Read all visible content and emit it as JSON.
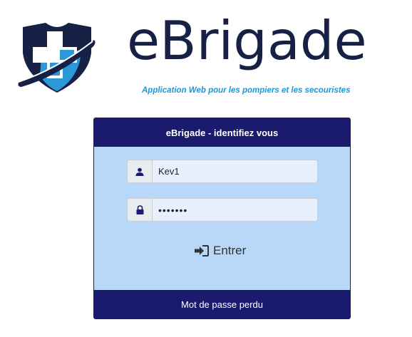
{
  "brand": {
    "name": "eBrigade",
    "tagline": "Application Web pour les pompiers et les secouristes",
    "colors": {
      "navy": "#172045",
      "accent_blue": "#1f96d6",
      "header_bg": "#1a1a6e",
      "panel_bg": "#b7d8f8"
    }
  },
  "login": {
    "title": "eBrigade - identifiez vous",
    "username": {
      "value": "Kev1",
      "icon": "user-icon"
    },
    "password": {
      "value": "•••••••",
      "icon": "lock-icon"
    },
    "submit": {
      "label": "Entrer",
      "icon": "sign-in-icon"
    },
    "forgot_password": "Mot de passe perdu"
  }
}
